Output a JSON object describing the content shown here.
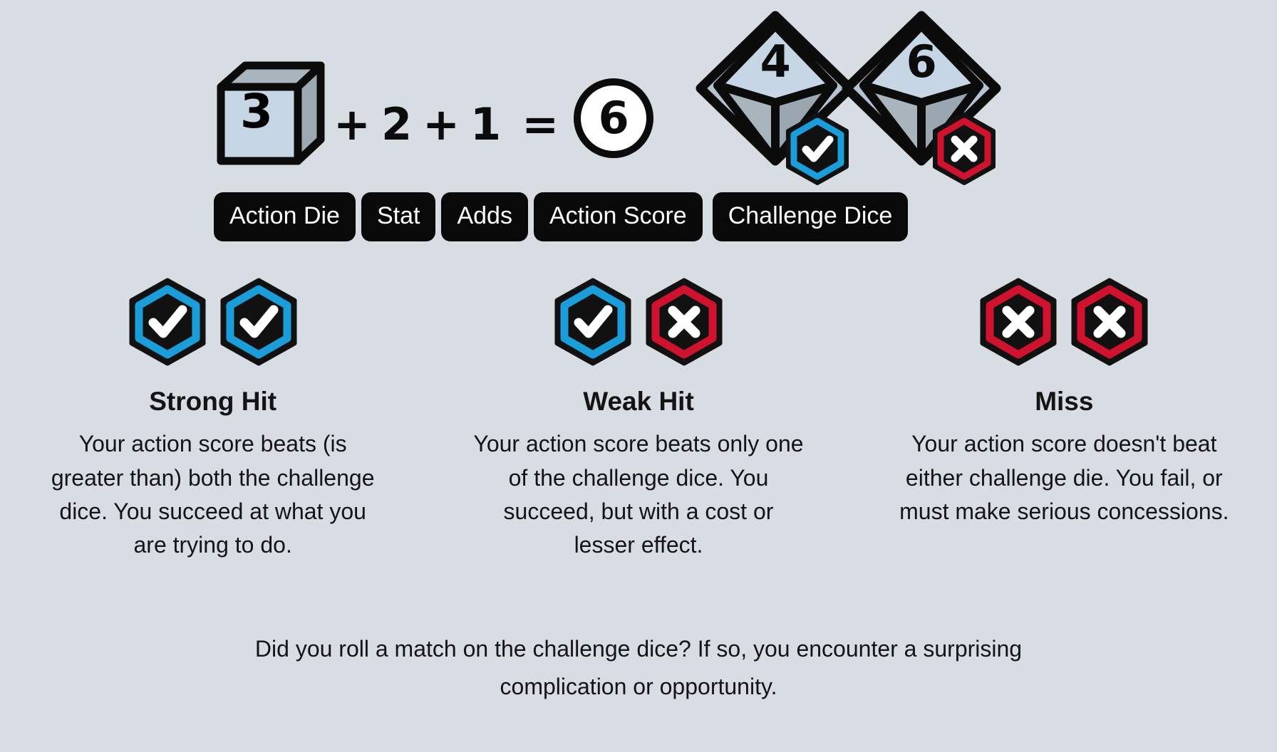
{
  "background_color": "#d7dde3",
  "colors": {
    "hit_blue": "#1b9dd9",
    "miss_red": "#cf132e",
    "badge_black": "#111111",
    "die_face_light": "#c6d6e4",
    "die_face_mid": "#a9b4bd",
    "die_face_dark": "#8f9aa3",
    "outline_black": "#0b0b0b",
    "text_dark": "#141414",
    "pill_bg": "#090909",
    "pill_text": "#ffffff"
  },
  "formula": {
    "action_die": {
      "value": "3",
      "icon": "cube-die-icon"
    },
    "plus_1": "+",
    "stat": "2",
    "plus_2": "+",
    "adds": "1",
    "equals": "=",
    "action_score": "6",
    "challenge_dice": [
      {
        "value": "4",
        "result": "hit",
        "badge_icon": "check-hex-icon"
      },
      {
        "value": "6",
        "result": "miss",
        "badge_icon": "x-hex-icon"
      }
    ],
    "labels": [
      {
        "key": "action-die",
        "text": "Action Die"
      },
      {
        "key": "stat",
        "text": "Stat"
      },
      {
        "key": "adds",
        "text": "Adds"
      },
      {
        "key": "action-score",
        "text": "Action Score"
      },
      {
        "key": "challenge-dice",
        "text": "Challenge Dice"
      }
    ]
  },
  "outcomes": [
    {
      "key": "strong-hit",
      "title": "Strong Hit",
      "description": "Your action score beats (is greater than) both the challenge dice. You succeed at what you are trying to do.",
      "badges": [
        "check",
        "check"
      ]
    },
    {
      "key": "weak-hit",
      "title": "Weak Hit",
      "description": "Your action score beats only one of the challenge dice. You succeed, but with a cost or lesser effect.",
      "badges": [
        "check",
        "x"
      ]
    },
    {
      "key": "miss",
      "title": "Miss",
      "description": "Your action score doesn't beat either challenge die. You fail, or must make serious concessions.",
      "badges": [
        "x",
        "x"
      ]
    }
  ],
  "footer": {
    "note": "Did you roll a match on the challenge dice? If so, you encounter a surprising complication or opportunity."
  }
}
